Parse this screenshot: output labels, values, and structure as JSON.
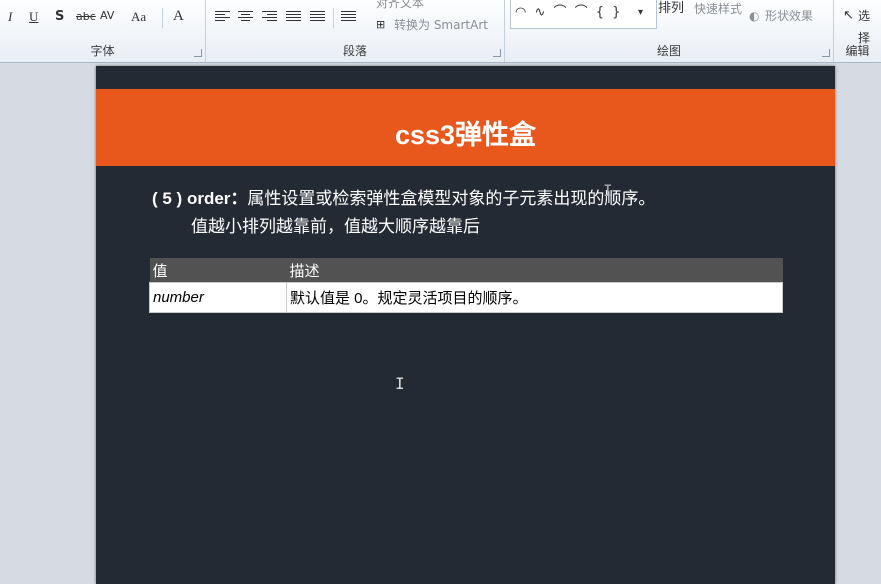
{
  "ribbon": {
    "font_group": {
      "label": "字体",
      "aa_label": "Aa",
      "av_label": "AV",
      "font_color_label": "A"
    },
    "paragraph_group": {
      "label": "段落",
      "align_text_label": "对齐文本",
      "smartart_label": "转换为 SmartArt"
    },
    "drawing_group": {
      "label": "绘图",
      "arrange_label": "排列",
      "quick_styles_label": "快速样式",
      "shape_effects_label": "形状效果"
    },
    "edit_group": {
      "label": "编辑",
      "select_label": "选择"
    }
  },
  "slide": {
    "title": "css3弹性盒",
    "line1_prefix": "( 5 ) order：",
    "line1_text": "属性设置或检索弹性盒模型对象的子元素出现的顺序。",
    "line2_text": "值越小排列越靠前，值越大顺序越靠后",
    "table": {
      "headers": [
        "值",
        "描述"
      ],
      "rows": [
        {
          "value": "number",
          "description": "默认值是 0。规定灵活项目的顺序。"
        }
      ]
    }
  },
  "colors": {
    "banner": "#e8581d",
    "slide_bg": "#232a33",
    "table_header": "#525252"
  }
}
